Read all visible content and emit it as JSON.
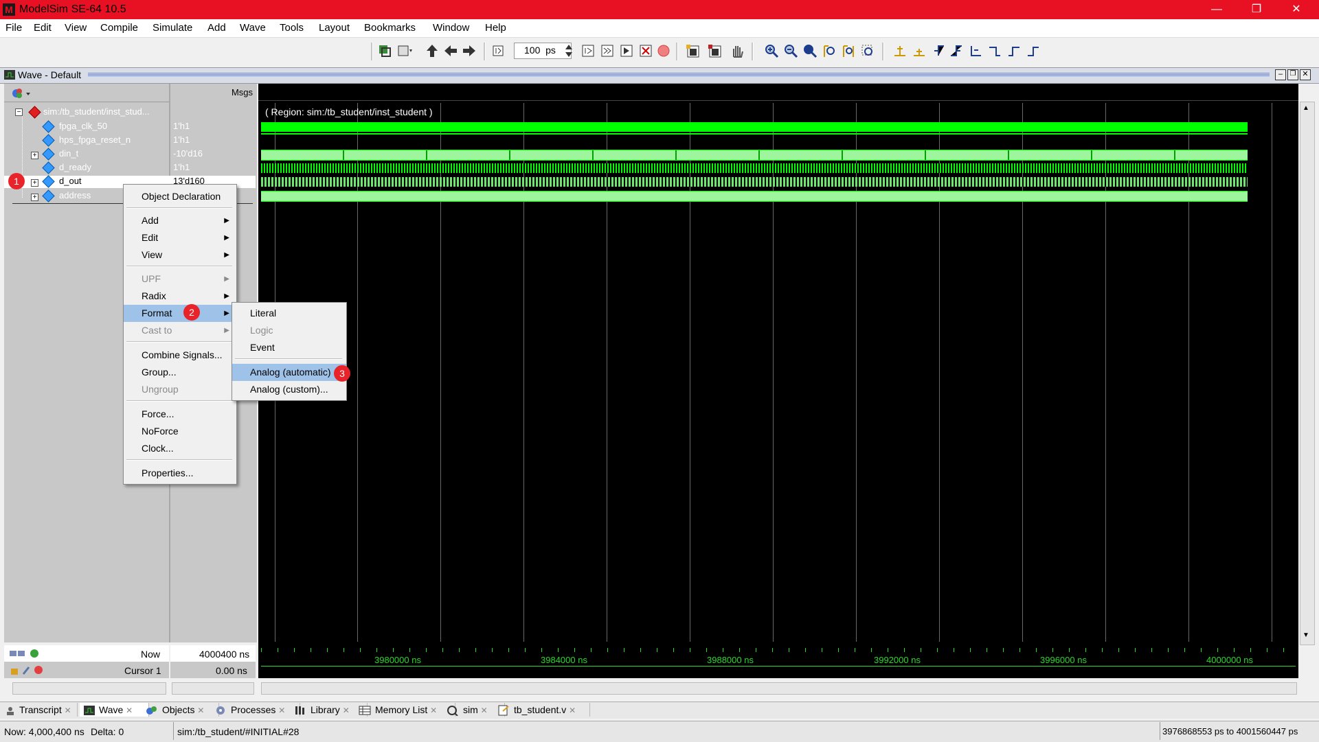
{
  "window": {
    "title": "ModelSim SE-64 10.5",
    "minimize": "—",
    "restore": "❐",
    "close": "✕"
  },
  "menu": [
    "File",
    "Edit",
    "View",
    "Compile",
    "Simulate",
    "Add",
    "Wave",
    "Tools",
    "Layout",
    "Bookmarks",
    "Window",
    "Help"
  ],
  "toolbar": {
    "zoom_value": "100",
    "zoom_unit": "ps"
  },
  "wave_panel": {
    "title": "Wave - Default",
    "msgs_label": "Msgs",
    "region": "( Region: sim:/tb_student/inst_student )"
  },
  "signals": [
    {
      "name": "sim:/tb_student/inst_stud...",
      "value": ""
    },
    {
      "name": "fpga_clk_50",
      "value": "1'h1"
    },
    {
      "name": "hps_fpga_reset_n",
      "value": "1'h1"
    },
    {
      "name": "din_t",
      "value": "-10'd16"
    },
    {
      "name": "d_ready",
      "value": "1'h1"
    },
    {
      "name": "d_out",
      "value": "13'd160"
    },
    {
      "name": "address",
      "value": ""
    }
  ],
  "cursor_info": {
    "now_label": "Now",
    "now_value": "4000400 ns",
    "cursor_label": "Cursor 1",
    "cursor_value": "0.00 ns"
  },
  "timeline": [
    "3980000 ns",
    "3984000 ns",
    "3988000 ns",
    "3992000 ns",
    "3996000 ns",
    "4000000 ns"
  ],
  "context_menu": {
    "items": [
      {
        "label": "Object Declaration",
        "disabled": false,
        "submenu": false
      },
      {
        "label": "Add",
        "disabled": false,
        "submenu": true
      },
      {
        "label": "Edit",
        "disabled": false,
        "submenu": true
      },
      {
        "label": "View",
        "disabled": false,
        "submenu": true
      },
      {
        "label": "UPF",
        "disabled": true,
        "submenu": true
      },
      {
        "label": "Radix",
        "disabled": false,
        "submenu": true
      },
      {
        "label": "Format",
        "disabled": false,
        "submenu": true,
        "highlighted": true
      },
      {
        "label": "Cast to",
        "disabled": true,
        "submenu": true
      },
      {
        "label": "Combine Signals...",
        "disabled": false,
        "submenu": false
      },
      {
        "label": "Group...",
        "disabled": false,
        "submenu": false
      },
      {
        "label": "Ungroup",
        "disabled": true,
        "submenu": false
      },
      {
        "label": "Force...",
        "disabled": false,
        "submenu": false
      },
      {
        "label": "NoForce",
        "disabled": false,
        "submenu": false
      },
      {
        "label": "Clock...",
        "disabled": false,
        "submenu": false
      },
      {
        "label": "Properties...",
        "disabled": false,
        "submenu": false
      }
    ]
  },
  "format_submenu": {
    "items": [
      {
        "label": "Literal",
        "disabled": false
      },
      {
        "label": "Logic",
        "disabled": true
      },
      {
        "label": "Event",
        "disabled": false
      },
      {
        "label": "Analog (automatic)",
        "disabled": false,
        "highlighted": true
      },
      {
        "label": "Analog (custom)...",
        "disabled": false
      }
    ]
  },
  "badges": [
    "1",
    "2",
    "3"
  ],
  "tabs": [
    "Transcript",
    "Wave",
    "Objects",
    "Processes",
    "Library",
    "Memory List",
    "sim",
    "tb_student.v"
  ],
  "status": {
    "now": "Now: 4,000,400 ns",
    "delta": "Delta: 0",
    "path": "sim:/tb_student/#INITIAL#28",
    "right": "3976868553 ps to 4001560447 ps"
  },
  "colors": {
    "title_bar": "#e81123",
    "wave_green": "#00ff00",
    "badge": "#e8232a",
    "highlight": "#9fc2e8"
  }
}
